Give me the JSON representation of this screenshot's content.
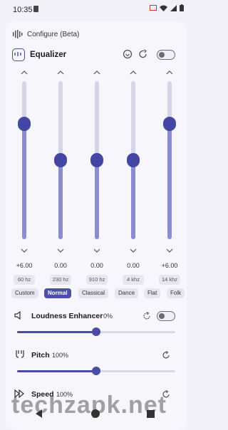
{
  "status_bar": {
    "time": "10:35"
  },
  "header": {
    "title": "Configure (Beta)"
  },
  "equalizer": {
    "title": "Equalizer",
    "enabled": false,
    "bands": [
      {
        "freq": "60 hz",
        "gain_label": "+6.00",
        "level": 0.73
      },
      {
        "freq": "230 hz",
        "gain_label": "0.00",
        "level": 0.5
      },
      {
        "freq": "910 hz",
        "gain_label": "0.00",
        "level": 0.5
      },
      {
        "freq": "4 khz",
        "gain_label": "0.00",
        "level": 0.5
      },
      {
        "freq": "14 khz",
        "gain_label": "+6.00",
        "level": 0.73
      }
    ],
    "presets": [
      "Custom",
      "Normal",
      "Classical",
      "Dance",
      "Flat",
      "Folk"
    ],
    "active_preset": "Normal"
  },
  "loudness": {
    "title": "Loudness Enhancer",
    "value": "0%",
    "enabled": false,
    "level": 0.5
  },
  "pitch": {
    "title": "Pitch",
    "value": "100%",
    "level": 0.5
  },
  "speed": {
    "title": "Speed",
    "value": "100%"
  },
  "watermark": "techzapk.net",
  "colors": {
    "accent": "#4a4ca2",
    "accent_light": "#8a8ed0",
    "background": "#f2f0f8"
  }
}
